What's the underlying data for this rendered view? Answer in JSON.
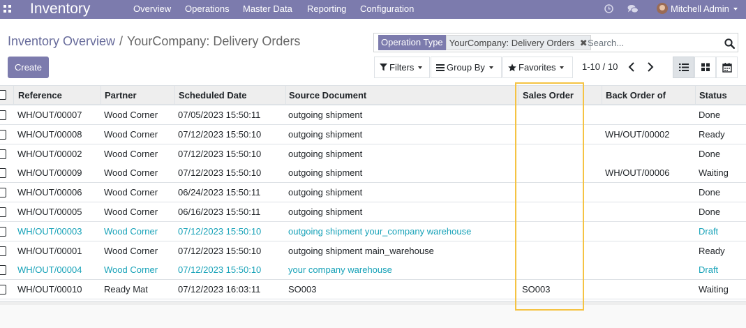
{
  "navbar": {
    "app_name": "Inventory",
    "menu": [
      "Overview",
      "Operations",
      "Master Data",
      "Reporting",
      "Configuration"
    ],
    "user": "Mitchell Admin",
    "icons": [
      "apps-icon",
      "clock-icon",
      "chat-icon"
    ]
  },
  "breadcrumb": {
    "parent": "Inventory Overview",
    "separator": "/",
    "current": "YourCompany: Delivery Orders"
  },
  "search": {
    "facet_label": "Operation Type",
    "facet_value": "YourCompany: Delivery Orders",
    "placeholder": "Search..."
  },
  "toolbar": {
    "create_label": "Create",
    "filters_label": "Filters",
    "groupby_label": "Group By",
    "favorites_label": "Favorites",
    "pager": "1-10 / 10"
  },
  "table": {
    "columns": [
      "Reference",
      "Partner",
      "Scheduled Date",
      "Source Document",
      "Sales Order",
      "Back Order of",
      "Status"
    ],
    "rows": [
      {
        "reference": "WH/OUT/00007",
        "partner": "Wood Corner",
        "scheduled": "07/05/2023 15:50:11",
        "source": "outgoing shipment",
        "sales_order": "",
        "back_order": "",
        "status": "Done",
        "draft": false
      },
      {
        "reference": "WH/OUT/00008",
        "partner": "Wood Corner",
        "scheduled": "07/12/2023 15:50:10",
        "source": "outgoing shipment",
        "sales_order": "",
        "back_order": "WH/OUT/00002",
        "status": "Ready",
        "draft": false
      },
      {
        "reference": "WH/OUT/00002",
        "partner": "Wood Corner",
        "scheduled": "07/12/2023 15:50:10",
        "source": "outgoing shipment",
        "sales_order": "",
        "back_order": "",
        "status": "Done",
        "draft": false
      },
      {
        "reference": "WH/OUT/00009",
        "partner": "Wood Corner",
        "scheduled": "07/12/2023 15:50:10",
        "source": "outgoing shipment",
        "sales_order": "",
        "back_order": "WH/OUT/00006",
        "status": "Waiting",
        "draft": false
      },
      {
        "reference": "WH/OUT/00006",
        "partner": "Wood Corner",
        "scheduled": "06/24/2023 15:50:11",
        "source": "outgoing shipment",
        "sales_order": "",
        "back_order": "",
        "status": "Done",
        "draft": false
      },
      {
        "reference": "WH/OUT/00005",
        "partner": "Wood Corner",
        "scheduled": "06/16/2023 15:50:11",
        "source": "outgoing shipment",
        "sales_order": "",
        "back_order": "",
        "status": "Done",
        "draft": false
      },
      {
        "reference": "WH/OUT/00003",
        "partner": "Wood Corner",
        "scheduled": "07/12/2023 15:50:10",
        "source": "outgoing shipment your_company warehouse",
        "sales_order": "",
        "back_order": "",
        "status": "Draft",
        "draft": true
      },
      {
        "reference": "WH/OUT/00001",
        "partner": "Wood Corner",
        "scheduled": "07/12/2023 15:50:10",
        "source": "outgoing shipment main_warehouse",
        "sales_order": "",
        "back_order": "",
        "status": "Ready",
        "draft": false
      },
      {
        "reference": "WH/OUT/00004",
        "partner": "Wood Corner",
        "scheduled": "07/12/2023 15:50:10",
        "source": "your company warehouse",
        "sales_order": "",
        "back_order": "",
        "status": "Draft",
        "draft": true
      },
      {
        "reference": "WH/OUT/00010",
        "partner": "Ready Mat",
        "scheduled": "07/12/2023 16:03:11",
        "source": "SO003",
        "sales_order": "SO003",
        "back_order": "",
        "status": "Waiting",
        "draft": false
      }
    ]
  },
  "colors": {
    "brand": "#7c7bad",
    "draft_text": "#17a2b8",
    "highlight": "#f5c342"
  }
}
